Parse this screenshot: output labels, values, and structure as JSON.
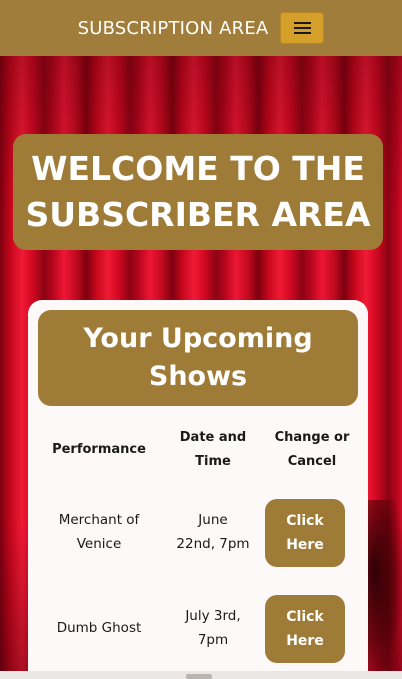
{
  "navbar": {
    "brand": "SUBSCRIPTION AREA",
    "menu_icon": "hamburger-menu-icon"
  },
  "hero": {
    "title_line1": "WELCOME TO THE",
    "title_line2": "SUBSCRIBER AREA"
  },
  "shows": {
    "title_line1": "Your Upcoming",
    "title_line2": "Shows",
    "headers": {
      "performance": "Performance",
      "datetime_line1": "Date and",
      "datetime_line2": "Time",
      "change_line1": "Change or",
      "change_line2": "Cancel"
    },
    "rows": [
      {
        "performance_line1": "Merchant of",
        "performance_line2": "Venice",
        "date_line1": "June",
        "date_line2": "22nd, 7pm",
        "action_line1": "Click",
        "action_line2": "Here"
      },
      {
        "performance_line1": "Dumb Ghost",
        "performance_line2": "",
        "date_line1": "July 3rd,",
        "date_line2": "7pm",
        "action_line1": "Click",
        "action_line2": "Here"
      }
    ]
  },
  "colors": {
    "gold": "#9f7b38",
    "menu_button": "#d4a02a",
    "card": "#fdf9f8",
    "curtain": "#c4041a"
  }
}
